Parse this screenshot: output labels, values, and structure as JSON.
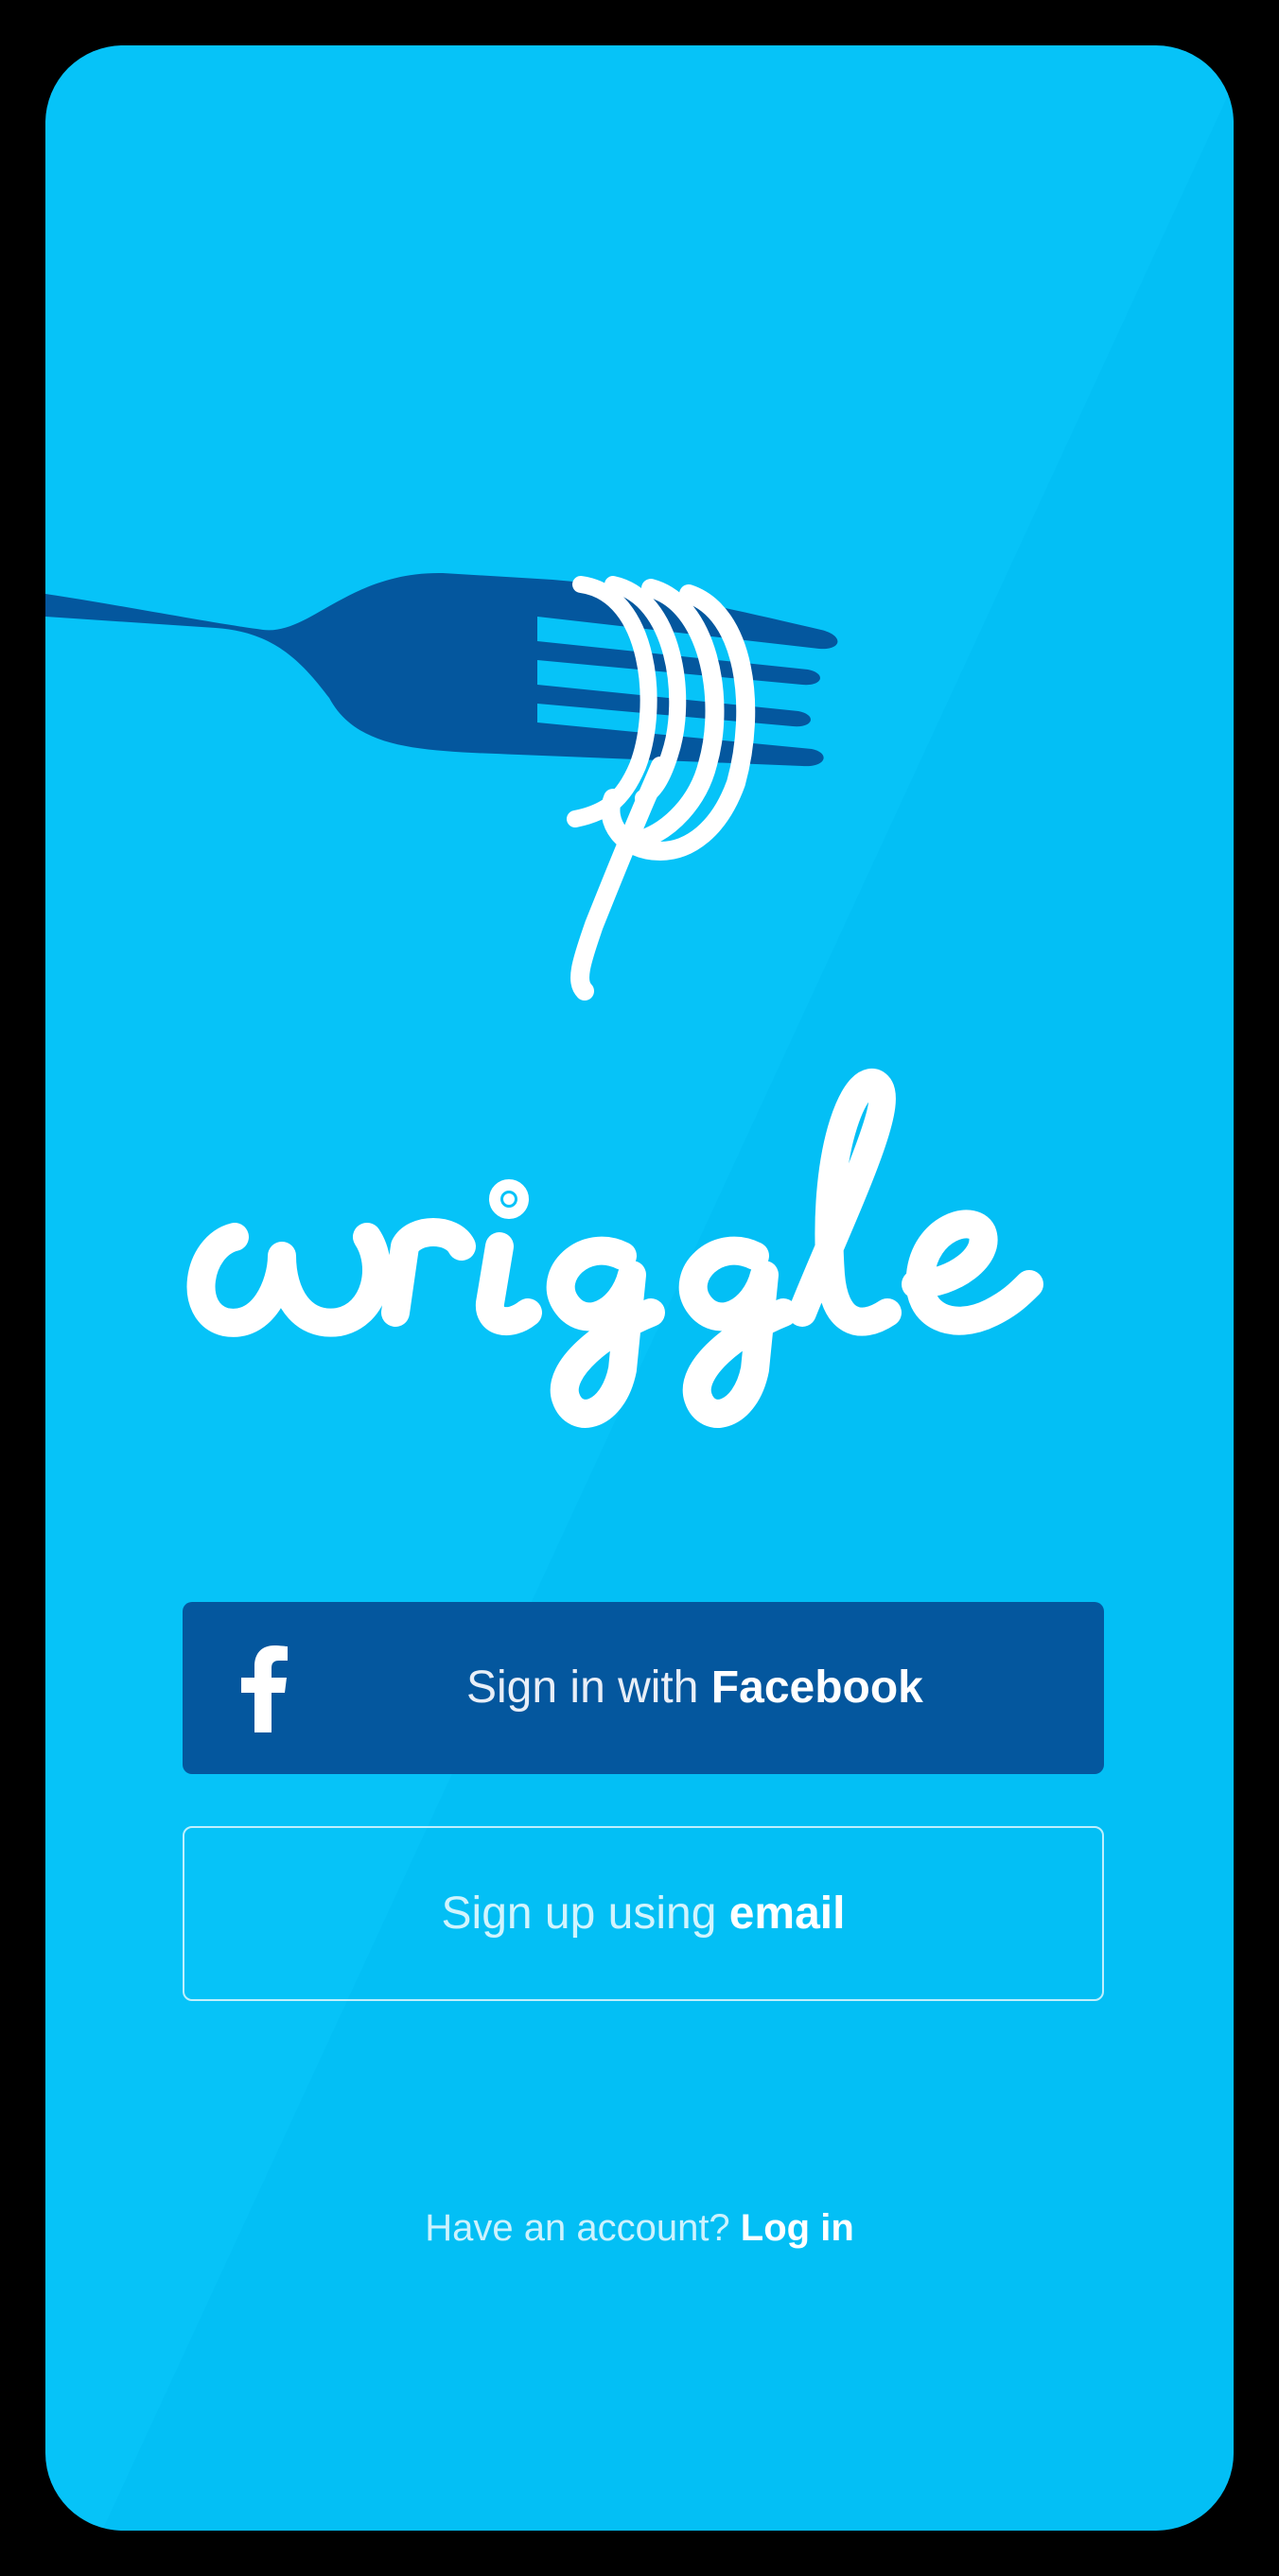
{
  "app": {
    "name": "wriggle"
  },
  "colors": {
    "background": "#06c3f8",
    "fork": "#04579e",
    "facebook_button": "#04579e",
    "text": "#ffffff"
  },
  "icons": {
    "fork": "fork-with-noodle-icon",
    "facebook": "facebook-f-icon"
  },
  "auth": {
    "facebook_button": {
      "prefix": "Sign in with ",
      "brand": "Facebook"
    },
    "email_button": {
      "prefix": "Sign up using ",
      "emphasis": "email"
    },
    "login": {
      "prompt": "Have an account? ",
      "link": "Log in"
    }
  }
}
